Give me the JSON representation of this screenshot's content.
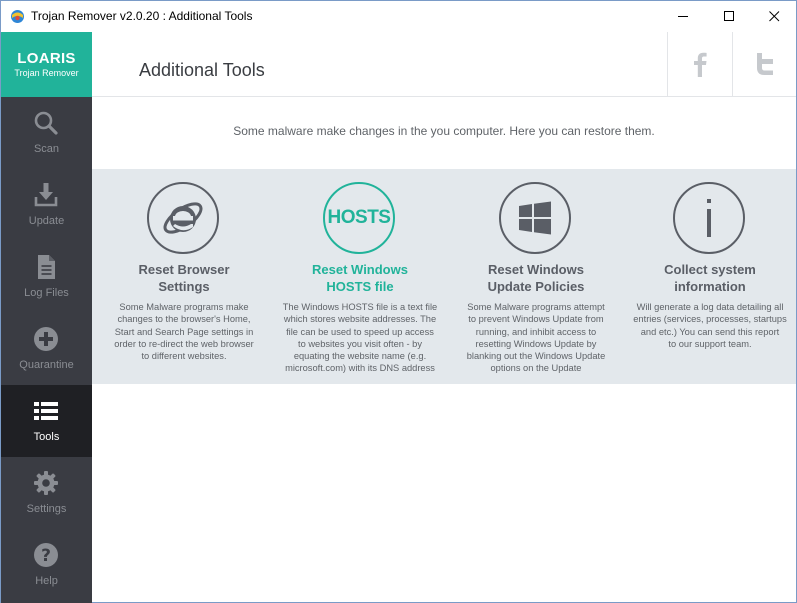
{
  "window": {
    "title": "Trojan Remover v2.0.20 : Additional Tools"
  },
  "logo": {
    "main": "LOARIS",
    "sub": "Trojan Remover"
  },
  "sidebar": {
    "items": [
      {
        "label": "Scan",
        "icon": "search-icon"
      },
      {
        "label": "Update",
        "icon": "download-icon"
      },
      {
        "label": "Log Files",
        "icon": "document-icon"
      },
      {
        "label": "Quarantine",
        "icon": "plus-circle-icon"
      },
      {
        "label": "Tools",
        "icon": "list-icon",
        "active": true
      },
      {
        "label": "Settings",
        "icon": "gear-icon"
      },
      {
        "label": "Help",
        "icon": "help-icon"
      }
    ]
  },
  "header": {
    "title": "Additional Tools"
  },
  "intro": "Some malware make changes in the you computer. Here you can restore them.",
  "tools": [
    {
      "title_line1": "Reset Browser",
      "title_line2": "Settings",
      "icon": "internet-explorer-icon",
      "desc_lines": [
        "Some Malware programs make",
        "changes to the browser's Home,",
        "Start and Search Page settings in",
        "order to re-direct the web browser",
        "to different websites."
      ]
    },
    {
      "title_line1": "Reset Windows",
      "title_line2": "HOSTS file",
      "icon_text": "HOSTS",
      "desc_lines": [
        "The Windows HOSTS file is a text file",
        "which stores website addresses. The",
        "file can be used to speed up access",
        "to websites you visit often - by",
        "equating the website name (e.g.",
        "microsoft.com) with its DNS address"
      ]
    },
    {
      "title_line1": "Reset Windows",
      "title_line2": "Update Policies",
      "icon": "windows-logo-icon",
      "desc_lines": [
        "Some Malware programs attempt",
        "to prevent Windows Update from",
        "running, and inhibit access to",
        "resetting Windows Update by",
        "blanking out the Windows Update",
        "options on the Update"
      ]
    },
    {
      "title_line1": "Collect system",
      "title_line2": "information",
      "icon": "info-icon",
      "desc_lines": [
        "Will generate a log data detailing all",
        "entries (services, processes, startups",
        "and etc.) You can send this report",
        "to our support team."
      ]
    }
  ],
  "colors": {
    "accent": "#21b39a",
    "sidebar": "#3a3c43",
    "sidebar_active": "#1f2024",
    "panel": "#e3e8ec"
  }
}
